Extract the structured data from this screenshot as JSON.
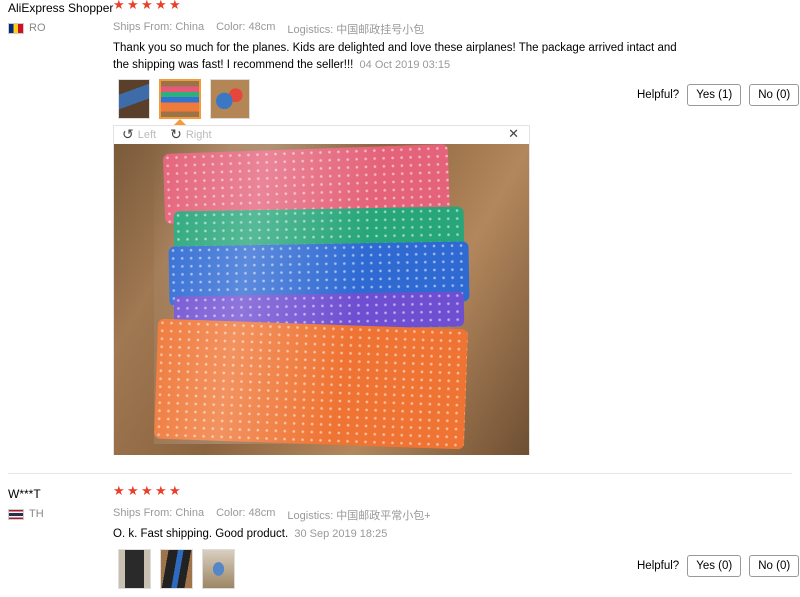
{
  "reviews": [
    {
      "user": "AliExpress Shopper",
      "country": "RO",
      "rating": 5,
      "meta": {
        "ships_from": "Ships From: China",
        "color": "Color: 48cm",
        "logistics": "Logistics: 中国邮政挂号小包"
      },
      "text": "Thank you so much for the planes. Kids are delighted and love these airplanes! The package arrived intact and the shipping was fast! I recommend the seller!!!",
      "date": "04 Oct 2019 03:15",
      "helpful_label": "Helpful?",
      "yes_label": "Yes (1)",
      "no_label": "No (0)"
    },
    {
      "user": "W***T",
      "country": "TH",
      "rating": 5,
      "meta": {
        "ships_from": "Ships From: China",
        "color": "Color: 48cm",
        "logistics": "Logistics: 中国邮政平常小包+"
      },
      "text": "O. k. Fast shipping. Good product.",
      "date": "30 Sep 2019 18:25",
      "helpful_label": "Helpful?",
      "yes_label": "Yes (0)",
      "no_label": "No (0)"
    }
  ],
  "viewer": {
    "rotate_left": "Left",
    "rotate_right": "Right"
  },
  "icons": {
    "star": "star-icon",
    "rotate_left": "rotate-left-icon",
    "rotate_right": "rotate-right-icon",
    "close": "close-icon"
  },
  "colors": {
    "star": "#e8402c",
    "selected_thumb": "#f39a3c",
    "muted_text": "#999999"
  }
}
